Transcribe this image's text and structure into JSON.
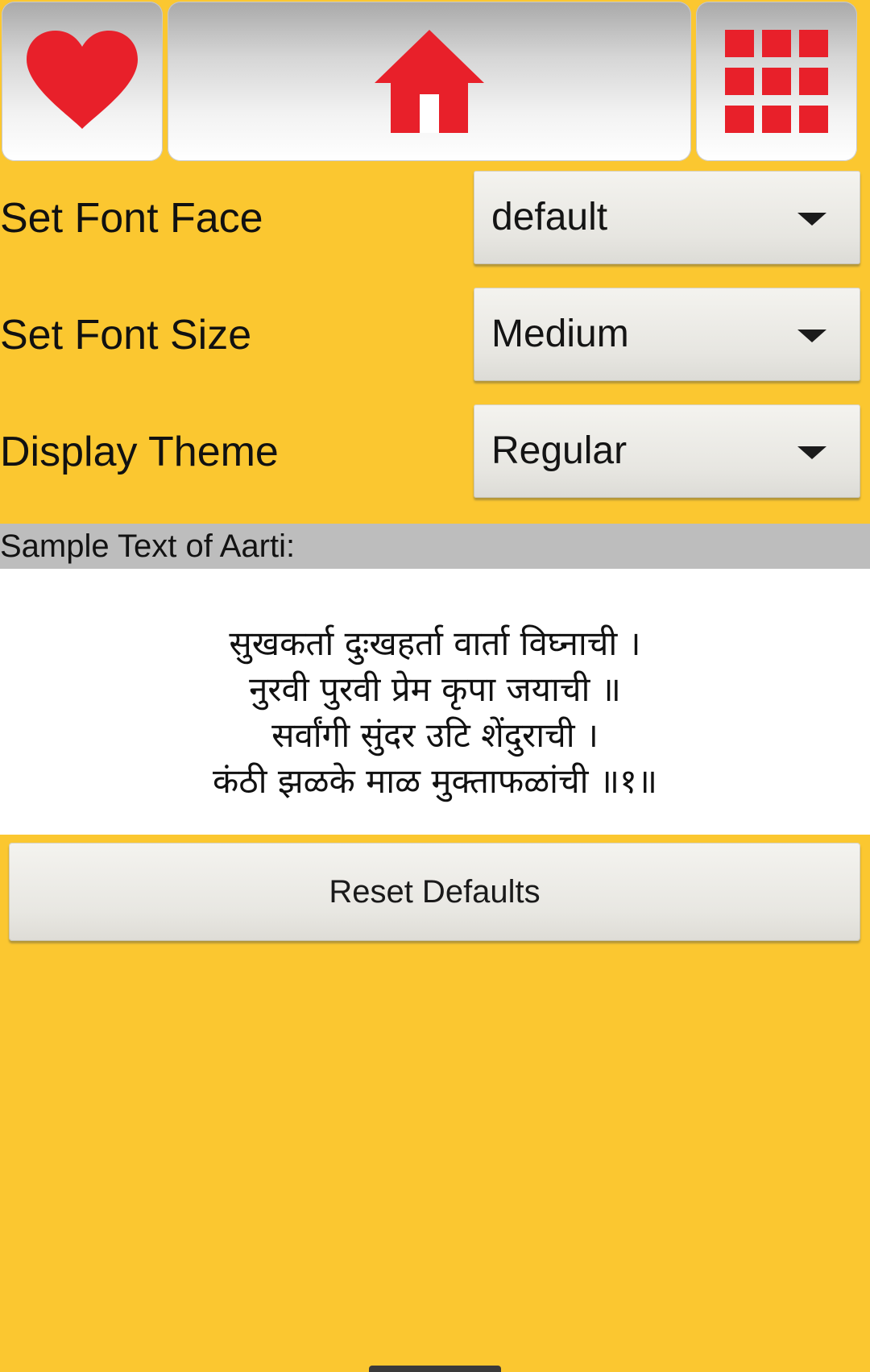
{
  "toolbar": {
    "favorite_icon": "heart-icon",
    "home_icon": "home-icon",
    "menu_icon": "grid-menu-icon",
    "icon_color": "#E8202A"
  },
  "settings": {
    "font_face": {
      "label": "Set Font Face",
      "value": "default"
    },
    "font_size": {
      "label": "Set Font Size",
      "value": "Medium"
    },
    "theme": {
      "label": "Display Theme",
      "value": "Regular"
    }
  },
  "sample": {
    "header": "Sample Text of Aarti:",
    "lines": [
      "सुखकर्ता दुःखहर्ता वार्ता विघ्नाची ।",
      "नुरवी पुरवी प्रेम कृपा जयाची ॥",
      "सर्वांगी सुंदर उटि शेंदुराची ।",
      "कंठी झळके माळ मुक्ताफळांची ॥१॥"
    ]
  },
  "reset_label": "Reset Defaults",
  "colors": {
    "background": "#FBC730",
    "header_band": "#BDBDBD",
    "accent": "#E8202A"
  }
}
